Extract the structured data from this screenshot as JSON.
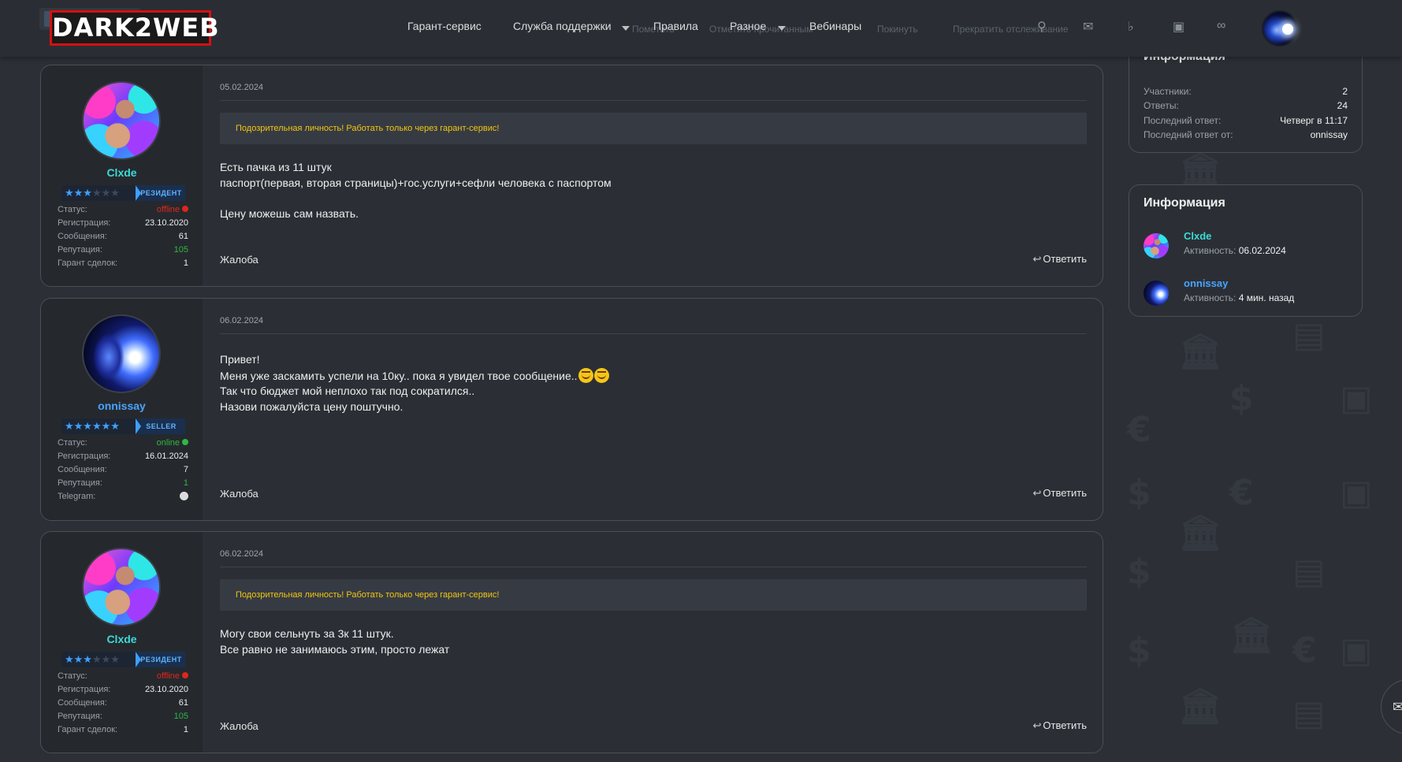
{
  "header": {
    "logo": "DARK2WEB",
    "nav": [
      {
        "label": "Гарант-сервис"
      },
      {
        "label": "Служба поддержки"
      },
      {
        "label": "Правила"
      },
      {
        "label": "Разное"
      },
      {
        "label": "Вебинары"
      }
    ],
    "ghost_actions": [
      "Пометить",
      "Отметить прочитанным",
      "Покинуть",
      "Прекратить отслеживание"
    ],
    "icons": [
      "search-icon",
      "mail-icon",
      "bell-icon",
      "cart-icon",
      "link-icon"
    ]
  },
  "posts": [
    {
      "date": "05.02.2024",
      "username": "Clxde",
      "username_color": "#3ddad7",
      "stars_on": 3,
      "rank": "РЕЗИДЕНТ",
      "warning": "Подозрительная личность! Работать только через гарант-сервис!",
      "stats": [
        {
          "label": "Статус:",
          "value": "offline"
        },
        {
          "label": "Регистрация:",
          "value": "23.10.2020"
        },
        {
          "label": "Сообщения:",
          "value": "61"
        },
        {
          "label": "Репутация:",
          "value": "105"
        },
        {
          "label": "Гарант сделок:",
          "value": "1"
        }
      ],
      "lines": [
        "Есть пачка из 11 штук",
        "паспорт(первая, вторая страницы)+гос.услуги+сефли человека с паспортом",
        "",
        "Цену можешь сам назвать."
      ],
      "complaint": "Жалоба",
      "reply": "Ответить"
    },
    {
      "date": "06.02.2024",
      "username": "onnissay",
      "username_color": "#4aa3ff",
      "stars_on": 6,
      "rank": "SELLER",
      "stats": [
        {
          "label": "Статус:",
          "value": "online"
        },
        {
          "label": "Регистрация:",
          "value": "16.01.2024"
        },
        {
          "label": "Сообщения:",
          "value": "7"
        },
        {
          "label": "Репутация:",
          "value": "1"
        },
        {
          "label": "Telegram:",
          "value": ""
        }
      ],
      "lines": [
        "Привет!",
        "Меня уже заскамить успели на 10ку.. пока я увидел твое сообщение..",
        "Так что бюджет мой неплохо так под сократился..",
        "Назови пожалуйста цену поштучно."
      ],
      "complaint": "Жалоба",
      "reply": "Ответить"
    },
    {
      "date": "06.02.2024",
      "username": "Clxde",
      "username_color": "#3ddad7",
      "stars_on": 3,
      "rank": "РЕЗИДЕНТ",
      "warning": "Подозрительная личность! Работать только через гарант-сервис!",
      "stats": [
        {
          "label": "Статус:",
          "value": "offline"
        },
        {
          "label": "Регистрация:",
          "value": "23.10.2020"
        },
        {
          "label": "Сообщения:",
          "value": "61"
        },
        {
          "label": "Репутация:",
          "value": "105"
        },
        {
          "label": "Гарант сделок:",
          "value": "1"
        }
      ],
      "lines": [
        "Могу свои сельнуть за 3к 11 штук.",
        "Все равно не занимаюсь этим, просто лежат"
      ],
      "complaint": "Жалоба",
      "reply": "Ответить"
    }
  ],
  "sidebar": {
    "thread_info": {
      "title": "Информация",
      "rows": [
        {
          "label": "Участники:",
          "value": "2"
        },
        {
          "label": "Ответы:",
          "value": "24"
        },
        {
          "label": "Последний ответ:",
          "value": "Четверг в 11:17"
        },
        {
          "label": "Последний ответ от:",
          "value": "onnissay"
        }
      ]
    },
    "members": {
      "title": "Информация",
      "activity_label": "Активность:",
      "items": [
        {
          "name": "Clxde",
          "activity": "06.02.2024",
          "color": "#3ddad7"
        },
        {
          "name": "onnissay",
          "activity": "4 мин. назад",
          "color": "#4aa3ff"
        }
      ]
    }
  },
  "colors": {
    "offline": "#e0261c",
    "online": "#2fb744",
    "reputation": "#2fb744",
    "warning_text": "#f2c511"
  }
}
